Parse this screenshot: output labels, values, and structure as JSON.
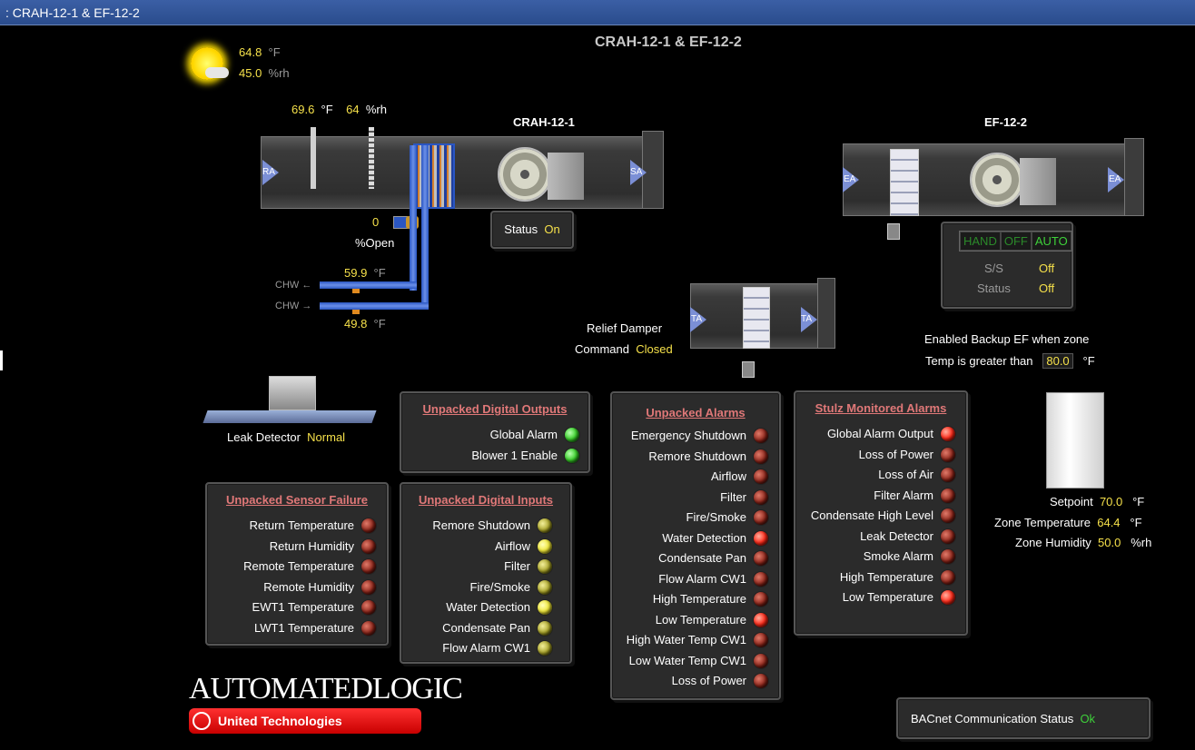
{
  "window": {
    "title": ": CRAH-12-1 & EF-12-2"
  },
  "page_title": "CRAH-12-1 & EF-12-2",
  "outdoor": {
    "temp": "64.8",
    "temp_unit": "°F",
    "humidity": "45.0",
    "humidity_unit": "%rh"
  },
  "crah": {
    "name": "CRAH-12-1",
    "return_temp": "69.6",
    "return_temp_unit": "°F",
    "return_hum": "64",
    "return_hum_unit": "%rh",
    "ra_label": "RA",
    "sa_label": "SA",
    "status_label": "Status",
    "status_value": "On",
    "valve_value": "0",
    "valve_label": "%Open",
    "chw_supply_label": "CHW",
    "chw_return_label": "CHW",
    "chw_top_temp": "59.9",
    "chw_bottom_temp": "49.8",
    "chw_unit": "°F"
  },
  "ef": {
    "name": "EF-12-2",
    "ea_in_label": "EA",
    "ea_out_label": "EA",
    "hoa": [
      "HAND",
      "OFF",
      "AUTO"
    ],
    "ss_label": "S/S",
    "ss_value": "Off",
    "status_label": "Status",
    "status_value": "Off",
    "backup_line1": "Enabled Backup EF when zone",
    "backup_line2": "Temp is greater than",
    "backup_value": "80.0",
    "backup_unit": "°F"
  },
  "relief": {
    "label": "Relief Damper",
    "command_label": "Command",
    "command_value": "Closed",
    "ta_in_label": "TA",
    "ta_out_label": "TA"
  },
  "leak": {
    "label": "Leak Detector",
    "value": "Normal"
  },
  "digital_outputs": {
    "title": "Unpacked Digital Outputs",
    "items": [
      {
        "label": "Global Alarm",
        "state": "green"
      },
      {
        "label": "Blower 1 Enable",
        "state": "green"
      }
    ]
  },
  "sensor_failure": {
    "title": "Unpacked Sensor Failure",
    "items": [
      {
        "label": "Return Temperature",
        "state": "dark"
      },
      {
        "label": "Return Humidity",
        "state": "dark"
      },
      {
        "label": "Remote Temperature",
        "state": "dark"
      },
      {
        "label": "Remote Humidity",
        "state": "dark"
      },
      {
        "label": "EWT1 Temperature",
        "state": "dark"
      },
      {
        "label": "LWT1 Temperature",
        "state": "dark"
      }
    ]
  },
  "digital_inputs": {
    "title": "Unpacked Digital Inputs",
    "items": [
      {
        "label": "Remore Shutdown",
        "state": "olive"
      },
      {
        "label": "Airflow",
        "state": "yellow"
      },
      {
        "label": "Filter",
        "state": "olive"
      },
      {
        "label": "Fire/Smoke",
        "state": "olive"
      },
      {
        "label": "Water Detection",
        "state": "yellow"
      },
      {
        "label": "Condensate Pan",
        "state": "olive"
      },
      {
        "label": "Flow Alarm CW1",
        "state": "olive"
      }
    ]
  },
  "alarms": {
    "title": "Unpacked Alarms",
    "items": [
      {
        "label": "Emergency Shutdown",
        "state": "dark"
      },
      {
        "label": "Remore Shutdown",
        "state": "dark"
      },
      {
        "label": "Airflow",
        "state": "dark"
      },
      {
        "label": "Filter",
        "state": "dark"
      },
      {
        "label": "Fire/Smoke",
        "state": "dark"
      },
      {
        "label": "Water Detection",
        "state": "red"
      },
      {
        "label": "Condensate Pan",
        "state": "dark"
      },
      {
        "label": "Flow Alarm CW1",
        "state": "dark"
      },
      {
        "label": "High Temperature",
        "state": "dark"
      },
      {
        "label": "Low Temperature",
        "state": "red"
      },
      {
        "label": "High Water Temp CW1",
        "state": "dark"
      },
      {
        "label": "Low Water Temp CW1",
        "state": "dark"
      },
      {
        "label": "Loss of Power",
        "state": "dark"
      }
    ]
  },
  "stulz": {
    "title": "Stulz Monitored Alarms",
    "items": [
      {
        "label": "Global Alarm Output",
        "state": "red"
      },
      {
        "label": "Loss of Power",
        "state": "dark"
      },
      {
        "label": "Loss of Air",
        "state": "dark"
      },
      {
        "label": "Filter Alarm",
        "state": "dark"
      },
      {
        "label": "Condensate High Level",
        "state": "dark"
      },
      {
        "label": "Leak Detector",
        "state": "dark"
      },
      {
        "label": "Smoke Alarm",
        "state": "dark"
      },
      {
        "label": "High Temperature",
        "state": "dark"
      },
      {
        "label": "Low Temperature",
        "state": "red"
      }
    ]
  },
  "zone": {
    "setpoint_label": "Setpoint",
    "setpoint_value": "70.0",
    "setpoint_unit": "°F",
    "temp_label": "Zone Temperature",
    "temp_value": "64.4",
    "temp_unit": "°F",
    "hum_label": "Zone Humidity",
    "hum_value": "50.0",
    "hum_unit": "%rh"
  },
  "bacnet": {
    "label": "BACnet Communication Status",
    "value": "Ok"
  },
  "logo": {
    "line1": "AUTOMATEDLOGIC",
    "line2": "United Technologies"
  },
  "colors": {
    "titlebar": "#2a4c8c",
    "value_yellow": "#f5e04a",
    "ok_green": "#3ed13a",
    "panel_title": "#e07878"
  }
}
